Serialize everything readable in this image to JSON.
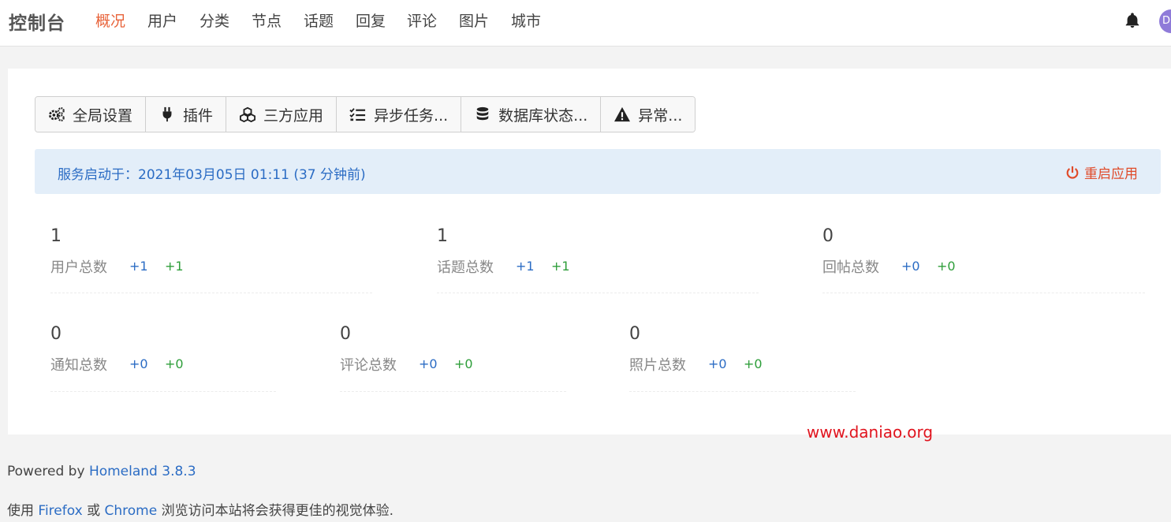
{
  "navbar": {
    "brand": "控制台",
    "items": [
      {
        "label": "概况",
        "active": true
      },
      {
        "label": "用户"
      },
      {
        "label": "分类"
      },
      {
        "label": "节点"
      },
      {
        "label": "话题"
      },
      {
        "label": "回复"
      },
      {
        "label": "评论"
      },
      {
        "label": "图片"
      },
      {
        "label": "城市"
      }
    ],
    "avatar_initial": "D"
  },
  "toolbar": [
    {
      "label": "全局设置",
      "icon": "gears-icon"
    },
    {
      "label": "插件",
      "icon": "plug-icon"
    },
    {
      "label": "三方应用",
      "icon": "cubes-icon"
    },
    {
      "label": "异步任务...",
      "icon": "tasks-icon"
    },
    {
      "label": "数据库状态...",
      "icon": "database-icon"
    },
    {
      "label": "异常...",
      "icon": "warning-icon"
    }
  ],
  "alert": {
    "text": "服务启动于：2021年03月05日 01:11 (37 分钟前)",
    "restart_label": "重启应用"
  },
  "stats": [
    {
      "value": "1",
      "label": "用户总数",
      "delta_a": "+1",
      "delta_b": "+1"
    },
    {
      "value": "1",
      "label": "话题总数",
      "delta_a": "+1",
      "delta_b": "+1"
    },
    {
      "value": "0",
      "label": "回帖总数",
      "delta_a": "+0",
      "delta_b": "+0"
    },
    {
      "value": "0",
      "label": "通知总数",
      "delta_a": "+0",
      "delta_b": "+0"
    },
    {
      "value": "0",
      "label": "评论总数",
      "delta_a": "+0",
      "delta_b": "+0"
    },
    {
      "value": "0",
      "label": "照片总数",
      "delta_a": "+0",
      "delta_b": "+0"
    }
  ],
  "watermark": "www.daniao.org",
  "footer": {
    "powered_by": "Powered by",
    "homeland_link": "Homeland 3.8.3",
    "use_text": "使用",
    "firefox_link": "Firefox",
    "or_text": "或",
    "chrome_link": "Chrome",
    "tail_text": "浏览访问本站将会获得更佳的视觉体验."
  },
  "colors": {
    "accent": "#e8633a",
    "link": "#2b6cc4",
    "positive": "#2e9e3a",
    "danger": "#e04b2a"
  }
}
